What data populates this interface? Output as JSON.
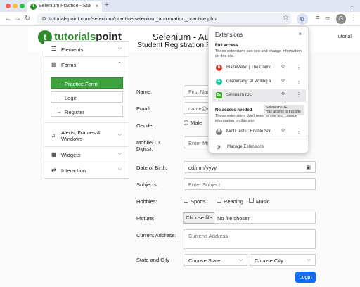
{
  "browser": {
    "tab_title": "Selenium Practice - Student",
    "tab_favicon_letter": "t",
    "url": "tutorialspoint.com/selenium/practice/selenium_automation_practice.php",
    "profile_initial": "G"
  },
  "header": {
    "logo_prefix": "tutorials",
    "logo_suffix": "point",
    "title": "Selenium - Automation",
    "right_link": "utorial"
  },
  "sidebar": {
    "elements_label": "Elements",
    "forms_label": "Forms",
    "practice_form_label": "Practice Form",
    "login_label": "Login",
    "register_label": "Register",
    "alerts_label": "Alerts, Frames & Windows",
    "widgets_label": "Widgets",
    "interaction_label": "Interaction"
  },
  "form": {
    "title": "Student Registration Fo",
    "name_label": "Name:",
    "name_placeholder": "First Nam",
    "email_label": "Email:",
    "email_placeholder": "name@e",
    "gender_label": "Gender:",
    "gender_male": "Male",
    "mobile_label": "Mobile(10 Digits):",
    "mobile_placeholder": "Enter Mo",
    "dob_label": "Date of Birth:",
    "dob_placeholder": "dd/mm/yyyy",
    "subjects_label": "Subjects:",
    "subjects_placeholder": "Enter Subject",
    "hobbies_label": "Hobbies:",
    "hobby_sports": "Sports",
    "hobby_reading": "Reading",
    "hobby_music": "Music",
    "picture_label": "Picture:",
    "choose_file": "Choose file",
    "no_file": "No file chosen",
    "address_label": "Current Address:",
    "address_placeholder": "Currend Address",
    "state_city_label": "State and City",
    "state_placeholder": "Choose State",
    "city_placeholder": "Choose City",
    "login_button": "Login"
  },
  "extensions": {
    "title": "Extensions",
    "full_access_heading": "Full access",
    "full_access_desc": "These extensions can see and change information on this site.",
    "items_full": [
      {
        "name": "BlazeMeter | The Continu...",
        "icon_color": "#d93025",
        "icon_letter": "B"
      },
      {
        "name": "Grammarly: AI Writing an...",
        "icon_color": "#15c39a",
        "icon_letter": "G"
      },
      {
        "name": "Selenium IDE",
        "icon_color": "#43b02a",
        "icon_letter": "Se"
      }
    ],
    "no_access_heading": "No access needed",
    "no_access_desc": "These extensions don't need to see and change information on this site.",
    "items_none": [
      {
        "name": "Metti Tests : Enable Scre...",
        "icon_color": "#7b7b7b",
        "icon_letter": "M"
      }
    ],
    "tooltip_title": "Selenium IDE",
    "tooltip_desc": "Has access to this site",
    "manage_label": "Manage Extensions"
  }
}
